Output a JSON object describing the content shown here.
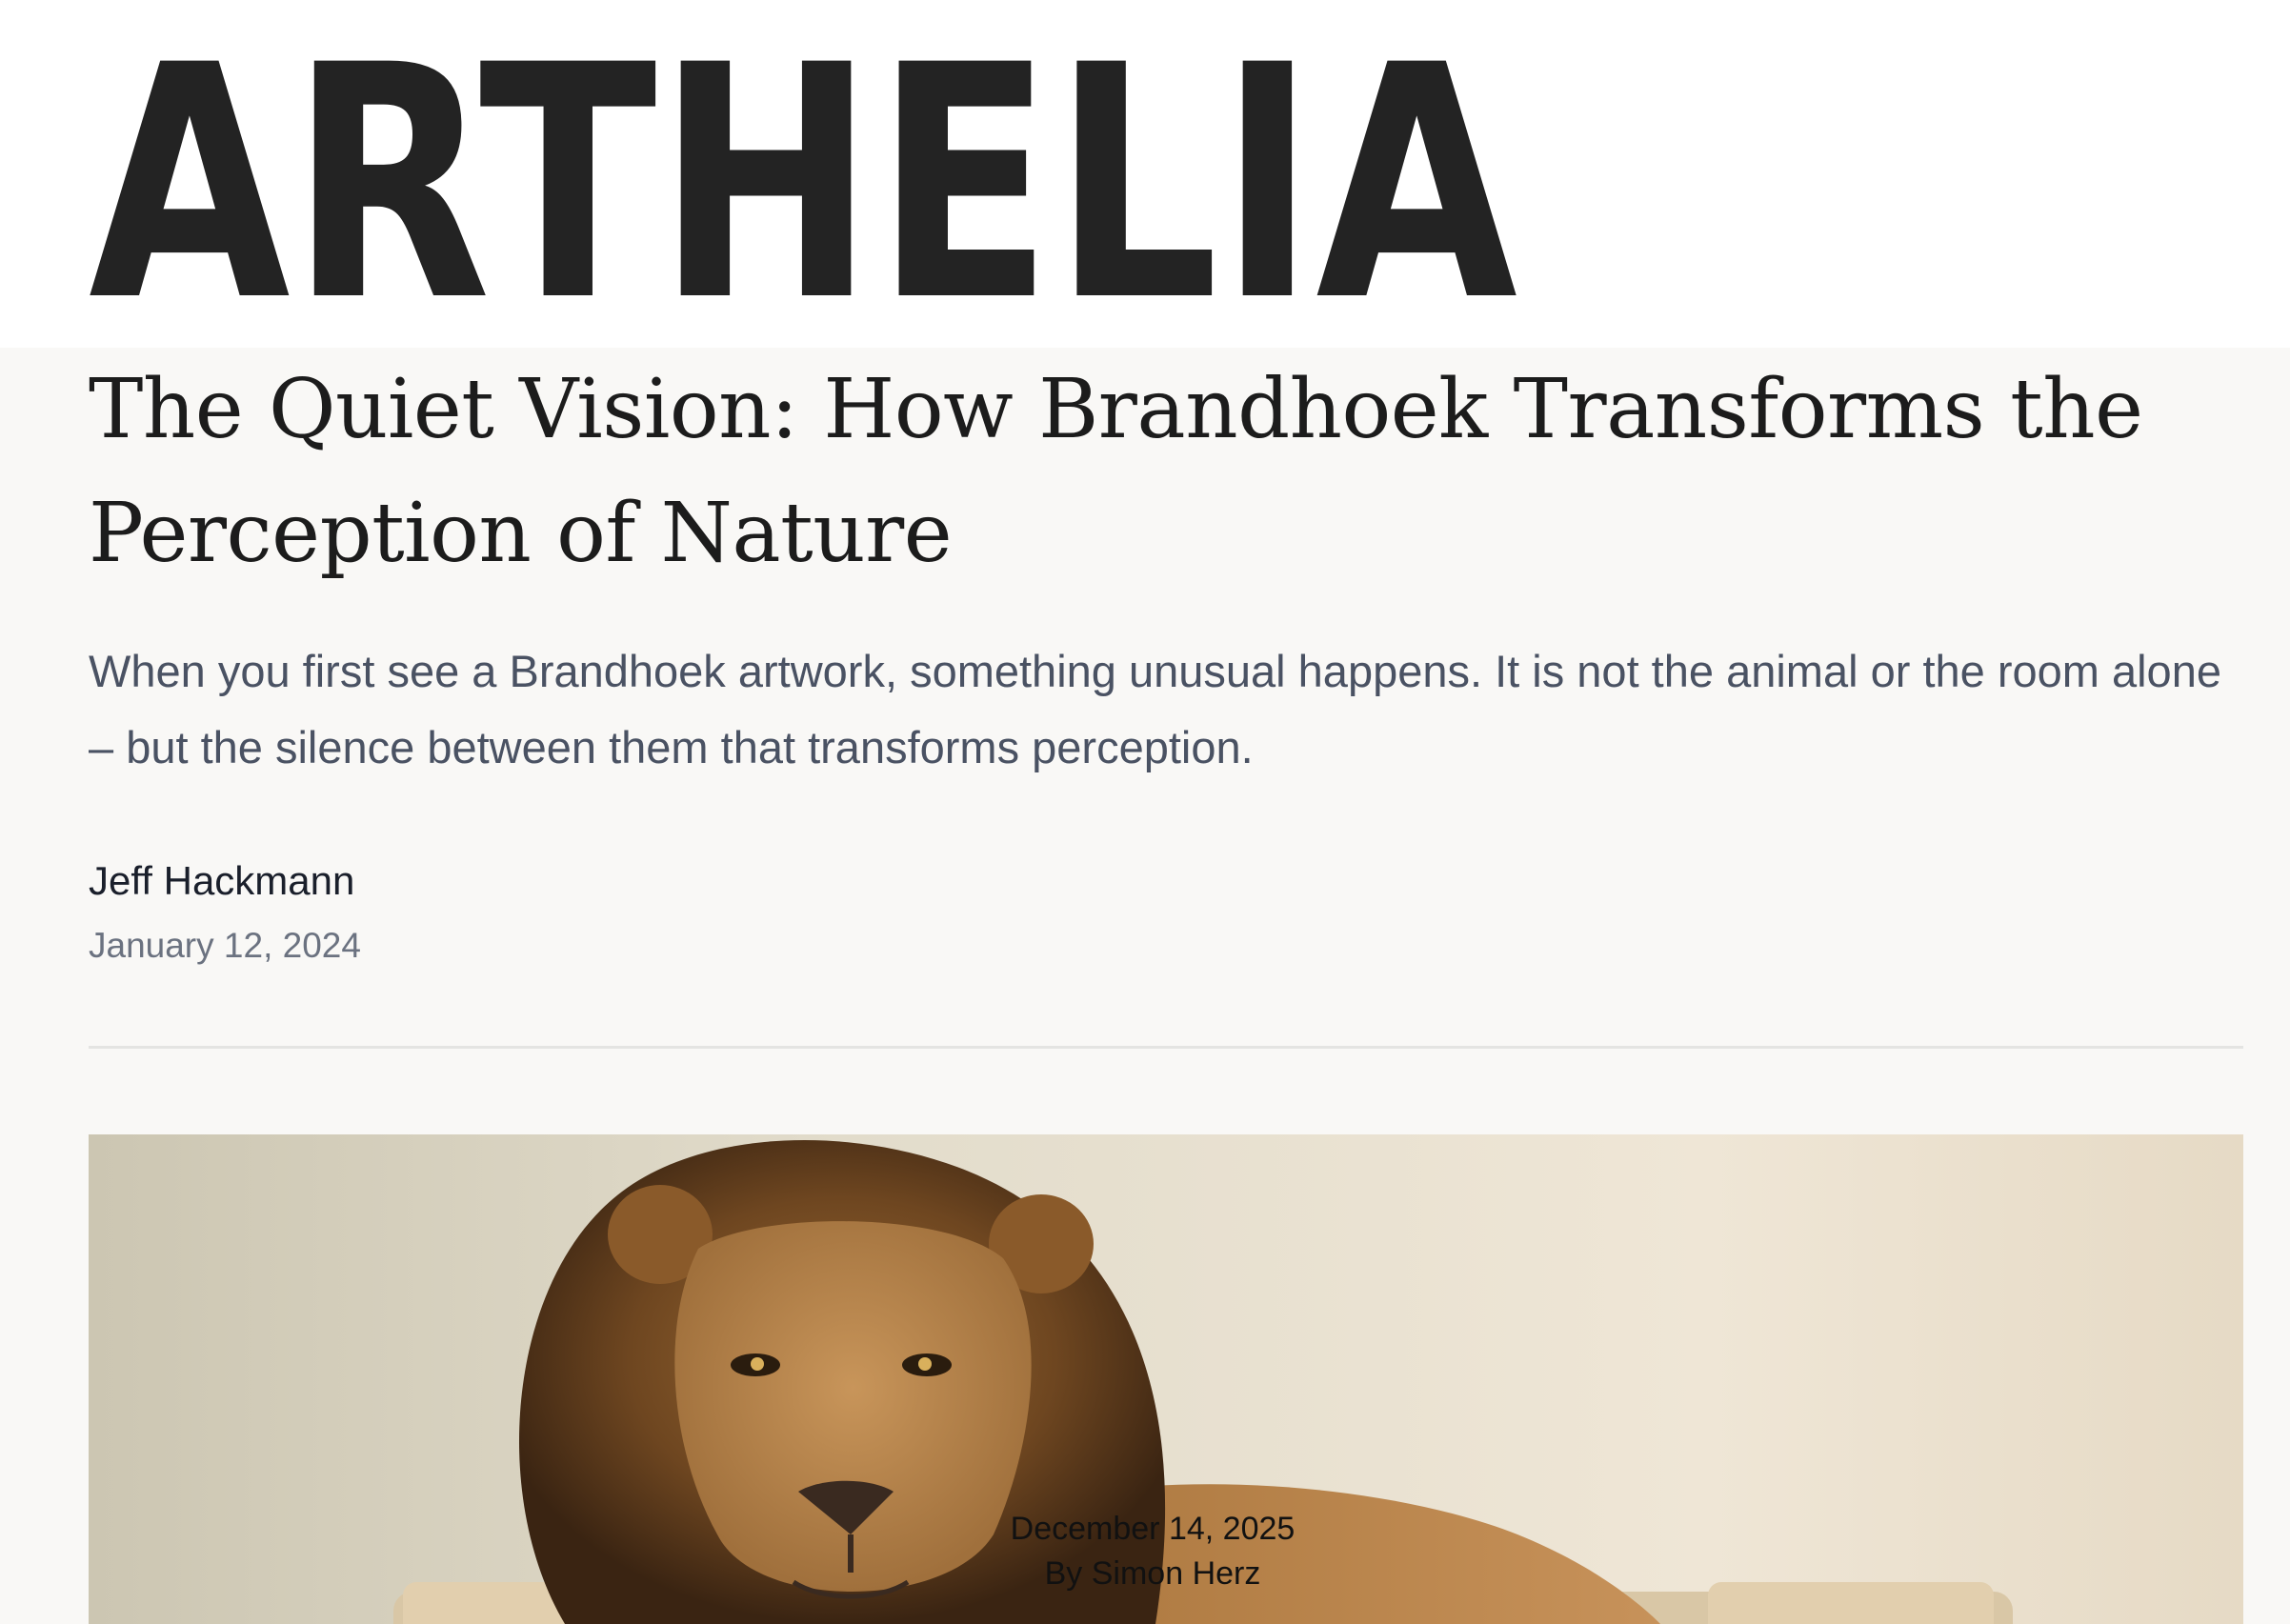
{
  "site": {
    "logo_text": "ARTHELIA"
  },
  "article": {
    "title": "The Quiet Vision: How Brandhoek Transforms the Perception of Nature",
    "lede": "When you first see a Brandhoek artwork, something unusual happens. It is not the animal or the room alone – but the silence between them that transforms perception.",
    "author": "Jeff Hackmann",
    "date": "January 12, 2024"
  },
  "hero_image": {
    "subject": "lion resting on a beige sofa in a minimal room",
    "overlay_date": "December 14, 2025",
    "overlay_byline": "By Simon Herz"
  },
  "colors": {
    "page_background": "#f9f8f6",
    "header_background": "#ffffff",
    "logo": "#232323",
    "title": "#1c1c1c",
    "lede": "#4a5263",
    "meta": "#6b7280",
    "divider": "#e4e4e2"
  }
}
